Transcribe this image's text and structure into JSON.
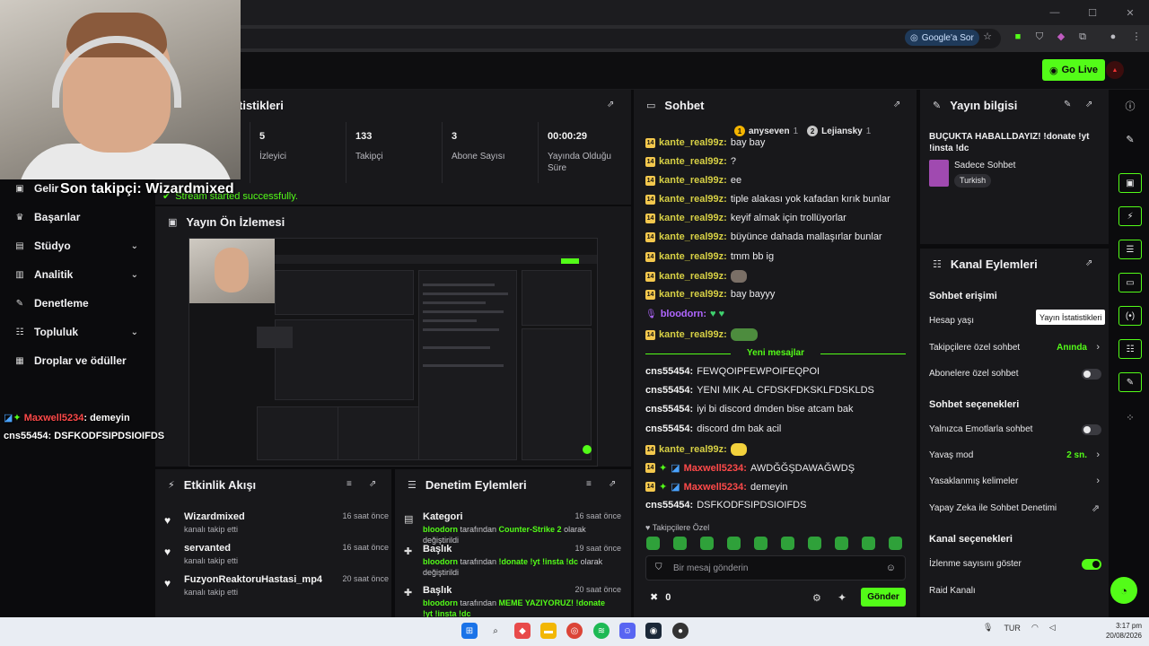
{
  "browser": {
    "google_pill": "Google'a Sor"
  },
  "topbar": {
    "go_live": "Go Live"
  },
  "nav": {
    "items": [
      {
        "label": "Gelir",
        "icon": "money-icon",
        "chevron": false
      },
      {
        "label": "Başarılar",
        "icon": "trophy-icon",
        "chevron": false
      },
      {
        "label": "Stüdyo",
        "icon": "studio-icon",
        "chevron": true
      },
      {
        "label": "Analitik",
        "icon": "chart-icon",
        "chevron": true
      },
      {
        "label": "Denetleme",
        "icon": "wrench-icon",
        "chevron": false
      },
      {
        "label": "Topluluk",
        "icon": "community-icon",
        "chevron": true
      },
      {
        "label": "Droplar ve ödüller",
        "icon": "gift-icon",
        "chevron": false
      }
    ]
  },
  "overlay": {
    "last_follower": "Son takipçi: Wizardmixed",
    "chat": [
      {
        "user": "Maxwell5234",
        "message": ": demeyin"
      },
      {
        "user": "cns55454",
        "message": ": DSFKODFSIPDSIOIFDS"
      }
    ]
  },
  "stats": {
    "title": "tistikleri",
    "items": [
      {
        "value": "5",
        "label": "İzleyici"
      },
      {
        "value": "133",
        "label": "Takipçi"
      },
      {
        "value": "3",
        "label": "Abone Sayısı"
      },
      {
        "value": "00:00:29",
        "label": "Yayında Olduğu Süre"
      }
    ],
    "status": "Stream started successfully."
  },
  "preview": {
    "title": "Yayın Ön İzlemesi"
  },
  "activity": {
    "title": "Etkinlik Akışı",
    "rows": [
      {
        "name": "Wizardmixed",
        "sub": "kanalı takip etti",
        "time": "16 saat önce"
      },
      {
        "name": "servanted",
        "sub": "kanalı takip etti",
        "time": "16 saat önce"
      },
      {
        "name": "FuzyonReaktoruHastasi_mp4",
        "sub": "kanalı takip etti",
        "time": "20 saat önce"
      }
    ]
  },
  "moderation": {
    "title": "Denetim Eylemleri",
    "rows": [
      {
        "name": "Kategori",
        "time": "16 saat önce",
        "user": "bloodorn",
        "mid": " tarafından ",
        "value": "Counter-Strike 2",
        "suffix": " olarak değiştirildi"
      },
      {
        "name": "Başlık",
        "time": "19 saat önce",
        "user": "bloodorn",
        "mid": " tarafından ",
        "value": "!donate !yt !insta !dc",
        "suffix": " olarak değiştirildi"
      },
      {
        "name": "Başlık",
        "time": "20 saat önce",
        "user": "bloodorn",
        "mid": " tarafından ",
        "value": "MEME YAZIYORUZ! !donate !yt !insta !dc",
        "suffix": ""
      }
    ]
  },
  "chat": {
    "title": "Sohbet",
    "top_users": [
      {
        "rank": "1",
        "name": "anyseven",
        "count": "1"
      },
      {
        "rank": "2",
        "name": "Lejiansky",
        "count": "1"
      }
    ],
    "messages": [
      {
        "user": "kante_real99z",
        "text": " bay bay",
        "color": "green"
      },
      {
        "user": "kante_real99z",
        "text": " ?",
        "color": "green"
      },
      {
        "user": "kante_real99z",
        "text": " ee",
        "color": "green"
      },
      {
        "user": "kante_real99z",
        "text": " tiple alakası yok kafadan kırık bunlar",
        "color": "green"
      },
      {
        "user": "kante_real99z",
        "text": " keyif almak için trollüyorlar",
        "color": "green"
      },
      {
        "user": "kante_real99z",
        "text": " büyünce dahada mallaşırlar bunlar",
        "color": "green"
      },
      {
        "user": "kante_real99z",
        "text": " tmm bb ig",
        "color": "green"
      },
      {
        "user": "kante_real99z",
        "text": "",
        "color": "green",
        "emote": "grey"
      },
      {
        "user": "kante_real99z",
        "text": " bay bayyy",
        "color": "green"
      },
      {
        "user": "bloodorn",
        "text": "",
        "color": "purple",
        "hearts": "♥ ♥"
      },
      {
        "user": "kante_real99z",
        "text": "",
        "color": "green",
        "emote": "pepe"
      }
    ],
    "new_messages": "Yeni mesajlar",
    "new_lines": [
      {
        "user": "cns55454",
        "text": " FEWQOIPFEWPOIFEQPOI",
        "color": "white"
      },
      {
        "user": "cns55454",
        "text": " YENI MIK AL CFDSKFDKSKLFDSKLDS",
        "color": "white"
      },
      {
        "user": "cns55454",
        "text": " iyi bi discord dmden bise atcam bak",
        "color": "white"
      },
      {
        "user": "cns55454",
        "text": " discord dm bak acil",
        "color": "white"
      },
      {
        "user": "kante_real99z",
        "text": "",
        "color": "green",
        "emote": "yel"
      },
      {
        "user": "Maxwell5234",
        "text": " AWDĞĞŞDAWAĞWDŞ",
        "color": "red"
      },
      {
        "user": "Maxwell5234",
        "text": " demeyin",
        "color": "red"
      },
      {
        "user": "cns55454",
        "text": " DSFKODFSIPDSIOIFDS",
        "color": "white"
      }
    ],
    "followers_only": "Takipçilere Özel",
    "input_placeholder": "Bir mesaj gönderin",
    "points": "0",
    "send": "Gönder"
  },
  "stream_info": {
    "title": "Yayın bilgisi",
    "stream_title": "BUÇUKTA HABALLDAYIZ! !donate !yt !insta !dc",
    "category": "Sadece Sohbet",
    "tag": "Turkish"
  },
  "channel_actions": {
    "title": "Kanal Eylemleri",
    "chat_access": "Sohbet erişimi",
    "account_age": "Hesap yaşı",
    "followers_only": "Takipçilere özel sohbet",
    "followers_only_value": "Anında",
    "subs_only": "Abonelere özel sohbet",
    "chat_options": "Sohbet seçenekleri",
    "emote_only": "Yalnızca Emotlarla sohbet",
    "slow_mode": "Yavaş mod",
    "slow_mode_value": "2 sn.",
    "banned_words": "Yasaklanmış kelimeler",
    "ai_moderation": "Yapay Zeka ile Sohbet Denetimi",
    "channel_options": "Kanal seçenekleri",
    "show_viewers": "İzlenme sayısını göster",
    "raid": "Raid Kanalı",
    "tooltip": "Yayın İstatistikleri"
  },
  "taskbar": {
    "lang": "TUR",
    "time": "3:17 pm",
    "date": "20/08/2026"
  },
  "colors": {
    "accent": "#53fc18",
    "panel": "#18181b",
    "background": "#0b0b0d"
  }
}
